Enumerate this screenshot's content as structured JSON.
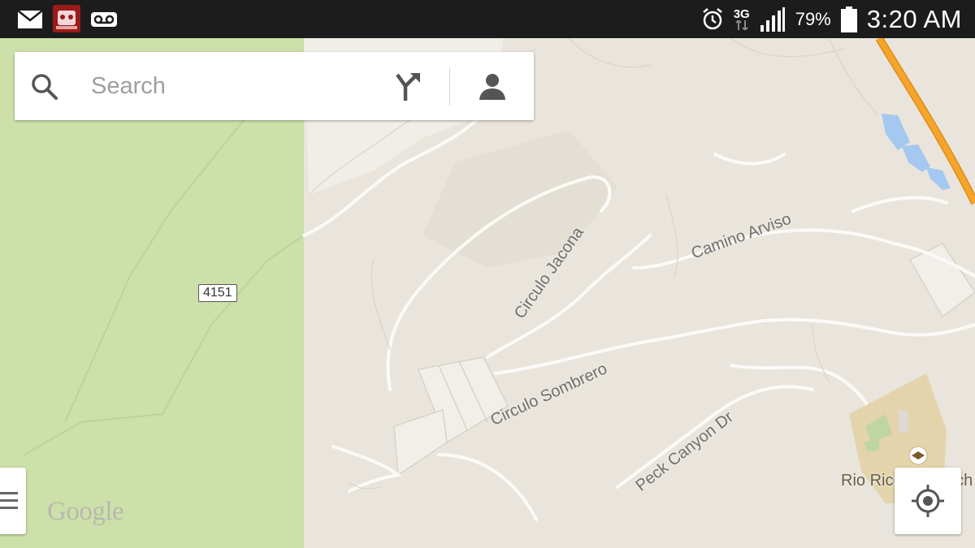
{
  "status_bar": {
    "battery_percent": "79%",
    "time": "3:20 AM",
    "network": "3G",
    "icons": [
      "mail-icon",
      "app-notification-icon",
      "voicemail-icon",
      "alarm-icon",
      "network-3g-icon",
      "signal-icon",
      "battery-icon"
    ]
  },
  "search": {
    "placeholder": "Search",
    "icons": [
      "search-icon",
      "directions-icon",
      "account-icon"
    ]
  },
  "map": {
    "route_shield": "4151",
    "roads": {
      "circulo_jacona": "Circulo Jacona",
      "camino_arviso": "Camino Arviso",
      "circulo_sombrero": "Circulo Sombrero",
      "peck_canyon": "Peck Canyon Dr",
      "rio_rico": "Rio Rico High Sch"
    },
    "attribution": "Google",
    "colors": {
      "park": "#cde0a9",
      "land": "#e9e5dc",
      "highway": "#f4a52a",
      "water": "#a4c8f0",
      "school": "#e4d4ab"
    }
  },
  "controls": {
    "menu_icon": "menu-icon",
    "locate_icon": "my-location-icon"
  }
}
